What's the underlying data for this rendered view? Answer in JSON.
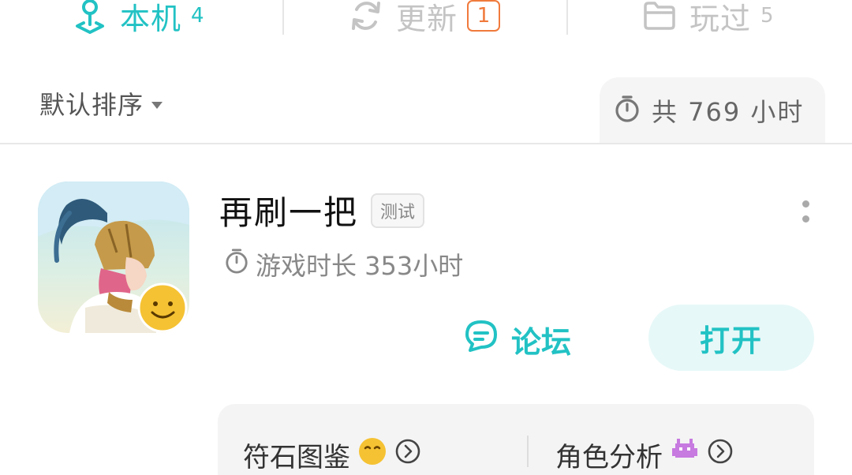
{
  "tabs": [
    {
      "label": "本机",
      "count": "4",
      "icon": "location-pin-icon",
      "active": true
    },
    {
      "label": "更新",
      "count": "1",
      "icon": "refresh-icon",
      "active": false
    },
    {
      "label": "玩过",
      "count": "5",
      "icon": "folder-icon",
      "active": false
    }
  ],
  "sort": {
    "label": "默认排序"
  },
  "total": {
    "label": "共 769 小时"
  },
  "game": {
    "title": "再刷一把",
    "tag": "测试",
    "play_time": "游戏时长 353小时",
    "forum_label": "论坛",
    "open_label": "打开"
  },
  "bottom_panel": {
    "items": [
      {
        "label": "符石图鉴",
        "icon": "smile-emoji-icon"
      },
      {
        "label": "角色分析",
        "icon": "space-invader-icon"
      }
    ]
  },
  "colors": {
    "accent": "#22c2c4",
    "badge": "#f07a3c",
    "inactive": "#c4c4c4"
  }
}
